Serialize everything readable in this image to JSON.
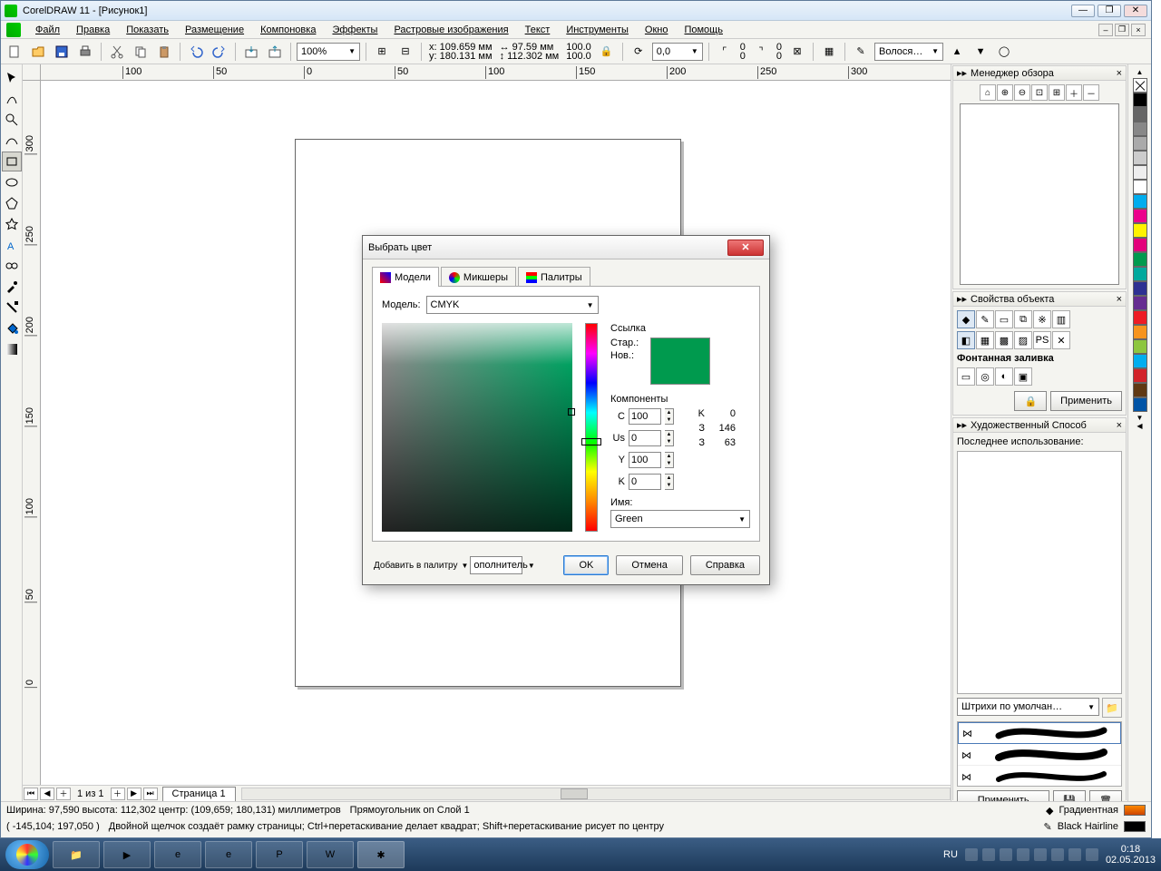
{
  "title": "CorelDRAW 11 - [Рисунок1]",
  "menu": [
    "Файл",
    "Правка",
    "Показать",
    "Размещение",
    "Компоновка",
    "Эффекты",
    "Растровые изображения",
    "Текст",
    "Инструменты",
    "Окно",
    "Помощь"
  ],
  "zoom": "100%",
  "coords": {
    "x": "x: 109.659 мм",
    "y": "y: 180.131 мм",
    "w": "↔ 97.59 мм",
    "h": "↕ 112.302 мм",
    "sx": "100.0",
    "sy": "100.0",
    "rot": "0,0",
    "px": "0",
    "py": "0"
  },
  "hair": "Волося…",
  "rulerUnits": "миллиметров",
  "hruler": [
    "100",
    "50",
    "0",
    "50",
    "100",
    "150",
    "200",
    "250",
    "300"
  ],
  "vruler": [
    "300",
    "250",
    "200",
    "150",
    "100",
    "50",
    "0"
  ],
  "dockers": {
    "nav": "Менеджер обзора",
    "obj": "Свойства объекта",
    "fillLabel": "Фонтанная заливка",
    "apply": "Применить",
    "art": "Художественный Способ",
    "lastUse": "Последнее использование:",
    "strokeCombo": "Штрихи по умолчан…",
    "apply2": "Применить"
  },
  "palette": [
    "#000",
    "#666",
    "#888",
    "#aaa",
    "#ccc",
    "#eee",
    "#fff",
    "#00adee",
    "#ec008c",
    "#fff200",
    "#e3007b",
    "#009a4e",
    "#00a99d",
    "#2e3192",
    "#662d91",
    "#ed1c24",
    "#f7941d",
    "#8dc63f",
    "#00aeef",
    "#d2232a",
    "#603913",
    "#0054a6"
  ],
  "pagebar": {
    "info": "1 из 1",
    "tab": "Страница 1"
  },
  "status": {
    "line1a": "Ширина: 97,590  высота: 112,302  центр: (109,659; 180,131)  миллиметров",
    "line1b": "Прямоугольник on Слой 1",
    "line2a": "( -145,104; 197,050 )",
    "line2b": "Двойной щелчок создаёт рамку страницы; Ctrl+перетаскивание делает квадрат; Shift+перетаскивание рисует по центру",
    "fillLbl": "Градиентная",
    "outlineLbl": "Black  Hairline"
  },
  "dialog": {
    "title": "Выбрать цвет",
    "tabs": [
      "Модели",
      "Микшеры",
      "Палитры"
    ],
    "modelLbl": "Модель:",
    "model": "CMYK",
    "linkLbl": "Ссылка",
    "old": "Стар.:",
    "new": "Нов.:",
    "compLbl": "Компоненты",
    "c": {
      "l": "C",
      "v": "100"
    },
    "m": {
      "l": "Us",
      "v": "0"
    },
    "y": {
      "l": "Y",
      "v": "100"
    },
    "k": {
      "l": "K",
      "v": "0"
    },
    "kOut": {
      "l": "K",
      "v": "0"
    },
    "r1": {
      "l": "З",
      "v": "146"
    },
    "r2": {
      "l": "З",
      "v": "63"
    },
    "nameLbl": "Имя:",
    "name": "Green",
    "addPal": "Добавить в палитру",
    "extra": "ополнитель",
    "ok": "OK",
    "cancel": "Отмена",
    "help": "Справка"
  },
  "tray": {
    "lang": "RU",
    "time": "0:18",
    "date": "02.05.2013"
  }
}
